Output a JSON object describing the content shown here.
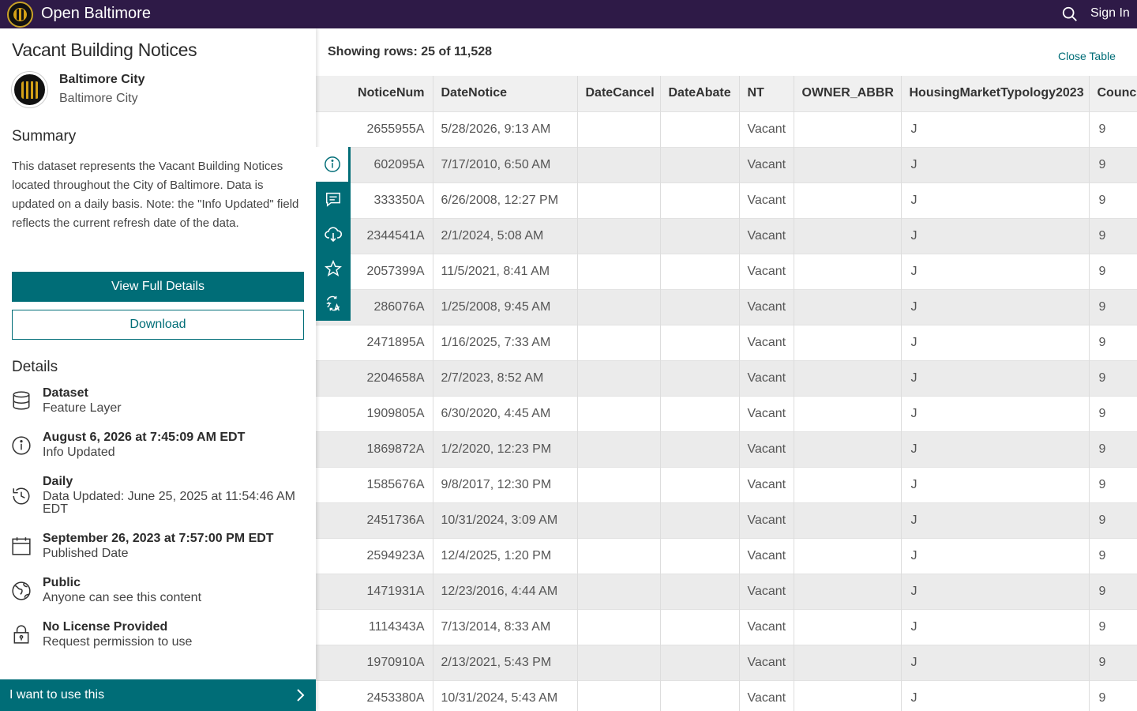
{
  "header": {
    "site_title": "Open Baltimore",
    "sign_in": "Sign In",
    "logo_icon": "city-seal-icon",
    "search_icon": "search-icon",
    "bg_color": "#2e1a47"
  },
  "dataset": {
    "title": "Vacant Building Notices",
    "owner_name": "Baltimore City",
    "owner_org": "Baltimore City",
    "summary_heading": "Summary",
    "summary": "This dataset represents the Vacant Building Notices located throughout the City of Baltimore. Data is updated on a daily basis. Note: the \"Info Updated\" field reflects the current refresh date of the data.",
    "view_full_details": "View Full Details",
    "download": "Download",
    "details_heading": "Details",
    "accent_color": "#006d77"
  },
  "details": [
    {
      "icon": "database-icon",
      "title": "Dataset",
      "sub": "Feature Layer"
    },
    {
      "icon": "info-icon",
      "title": "August 6, 2026 at 7:45:09 AM EDT",
      "sub": "Info Updated"
    },
    {
      "icon": "history-icon",
      "title": "Daily",
      "sub": "Data Updated: June 25, 2025 at 11:54:46 AM EDT"
    },
    {
      "icon": "calendar-icon",
      "title": "September 26, 2023 at 7:57:00 PM EDT",
      "sub": "Published Date"
    },
    {
      "icon": "globe-icon",
      "title": "Public",
      "sub": "Anyone can see this content"
    },
    {
      "icon": "lock-icon",
      "title": "No License Provided",
      "sub": "Request permission to use"
    }
  ],
  "cta": {
    "label": "I want to use this",
    "icon": "chevron-right-icon"
  },
  "table": {
    "rows_label": "Showing rows: 25 of 11,528",
    "close_label": "Close Table",
    "columns": [
      "NoticeNum",
      "DateNotice",
      "DateCancel",
      "DateAbate",
      "NT",
      "OWNER_ABBR",
      "HousingMarketTypology2023",
      "Council"
    ],
    "rows": [
      [
        "2655955A",
        "5/28/2026, 9:13 AM",
        "",
        "",
        "Vacant",
        "",
        "J",
        "9"
      ],
      [
        "602095A",
        "7/17/2010, 6:50 AM",
        "",
        "",
        "Vacant",
        "",
        "J",
        "9"
      ],
      [
        "333350A",
        "6/26/2008, 12:27 PM",
        "",
        "",
        "Vacant",
        "",
        "J",
        "9"
      ],
      [
        "2344541A",
        "2/1/2024, 5:08 AM",
        "",
        "",
        "Vacant",
        "",
        "J",
        "9"
      ],
      [
        "2057399A",
        "11/5/2021, 8:41 AM",
        "",
        "",
        "Vacant",
        "",
        "J",
        "9"
      ],
      [
        "286076A",
        "1/25/2008, 9:45 AM",
        "",
        "",
        "Vacant",
        "",
        "J",
        "9"
      ],
      [
        "2471895A",
        "1/16/2025, 7:33 AM",
        "",
        "",
        "Vacant",
        "",
        "J",
        "9"
      ],
      [
        "2204658A",
        "2/7/2023, 8:52 AM",
        "",
        "",
        "Vacant",
        "",
        "J",
        "9"
      ],
      [
        "1909805A",
        "6/30/2020, 4:45 AM",
        "",
        "",
        "Vacant",
        "",
        "J",
        "9"
      ],
      [
        "1869872A",
        "1/2/2020, 12:23 PM",
        "",
        "",
        "Vacant",
        "",
        "J",
        "9"
      ],
      [
        "1585676A",
        "9/8/2017, 12:30 PM",
        "",
        "",
        "Vacant",
        "",
        "J",
        "9"
      ],
      [
        "2451736A",
        "10/31/2024, 3:09 AM",
        "",
        "",
        "Vacant",
        "",
        "J",
        "9"
      ],
      [
        "2594923A",
        "12/4/2025, 1:20 PM",
        "",
        "",
        "Vacant",
        "",
        "J",
        "9"
      ],
      [
        "1471931A",
        "12/23/2016, 4:44 AM",
        "",
        "",
        "Vacant",
        "",
        "J",
        "9"
      ],
      [
        "1114343A",
        "7/13/2014, 8:33 AM",
        "",
        "",
        "Vacant",
        "",
        "J",
        "9"
      ],
      [
        "1970910A",
        "2/13/2021, 5:43 PM",
        "",
        "",
        "Vacant",
        "",
        "J",
        "9"
      ],
      [
        "2453380A",
        "10/31/2024, 5:43 AM",
        "",
        "",
        "Vacant",
        "",
        "J",
        "9"
      ]
    ]
  },
  "toolbar": [
    {
      "icon": "info-icon",
      "active": true
    },
    {
      "icon": "comment-icon",
      "active": false
    },
    {
      "icon": "cloud-download-icon",
      "active": false
    },
    {
      "icon": "star-icon",
      "active": false
    },
    {
      "icon": "translate-icon",
      "active": false
    }
  ]
}
